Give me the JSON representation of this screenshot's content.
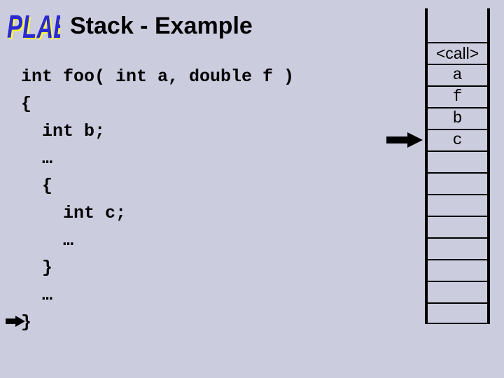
{
  "title": "Stack - Example",
  "code": "int foo( int a, double f )\n{\n  int b;\n  …\n  {\n    int c;\n    …\n  }\n  …\n}",
  "stack": {
    "cells": [
      {
        "label": "<call>",
        "mono": false
      },
      {
        "label": "a",
        "mono": true
      },
      {
        "label": "f",
        "mono": true
      },
      {
        "label": "b",
        "mono": true
      },
      {
        "label": "c",
        "mono": true
      },
      {
        "label": "",
        "mono": false
      },
      {
        "label": "",
        "mono": false
      },
      {
        "label": "",
        "mono": false
      },
      {
        "label": "",
        "mono": false
      },
      {
        "label": "",
        "mono": false
      },
      {
        "label": "",
        "mono": false
      },
      {
        "label": "",
        "mono": false
      },
      {
        "label": "",
        "mono": false
      }
    ],
    "pointer_index": 4
  }
}
